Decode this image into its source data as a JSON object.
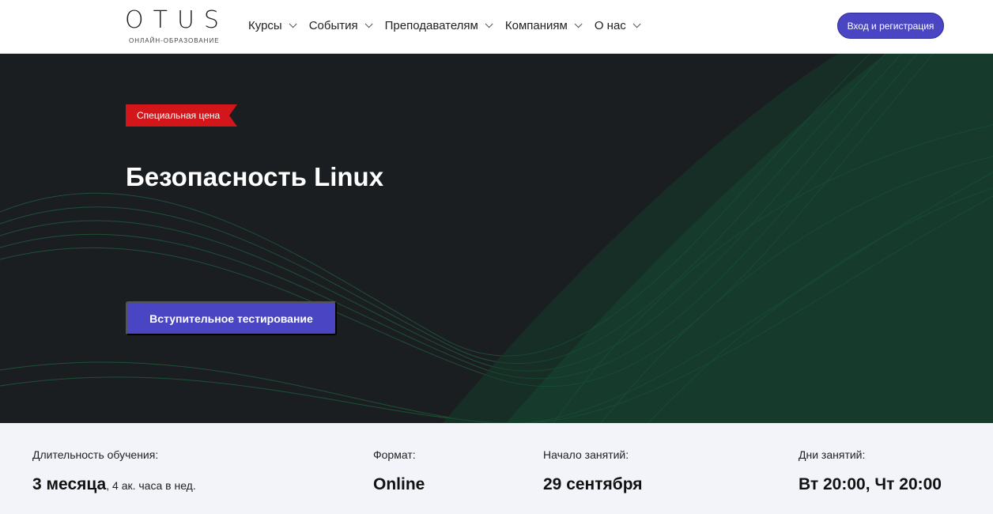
{
  "header": {
    "logo_text": "OTUS",
    "logo_subtitle": "ОНЛАЙН-ОБРАЗОВАНИЕ",
    "nav": [
      {
        "label": "Курсы"
      },
      {
        "label": "События"
      },
      {
        "label": "Преподавателям"
      },
      {
        "label": "Компаниям"
      },
      {
        "label": "О нас"
      }
    ],
    "login_label": "Вход и регистрация"
  },
  "hero": {
    "badge": "Специальная цена",
    "title": "Безопасность Linux",
    "cta_label": "Вступительное тестирование"
  },
  "info": [
    {
      "label": "Длительность обучения:",
      "value": "3 месяца",
      "extra": ", 4 ак. часа в нед."
    },
    {
      "label": "Формат:",
      "value": "Online",
      "extra": ""
    },
    {
      "label": "Начало занятий:",
      "value": "29 сентября",
      "extra": ""
    },
    {
      "label": "Дни занятий:",
      "value": "Вт 20:00, Чт 20:00",
      "extra": ""
    }
  ],
  "colors": {
    "accent": "#4a45c2",
    "badge": "#d2161a",
    "hero_bg": "#1b1e20",
    "wave": "#1f7a4a"
  }
}
